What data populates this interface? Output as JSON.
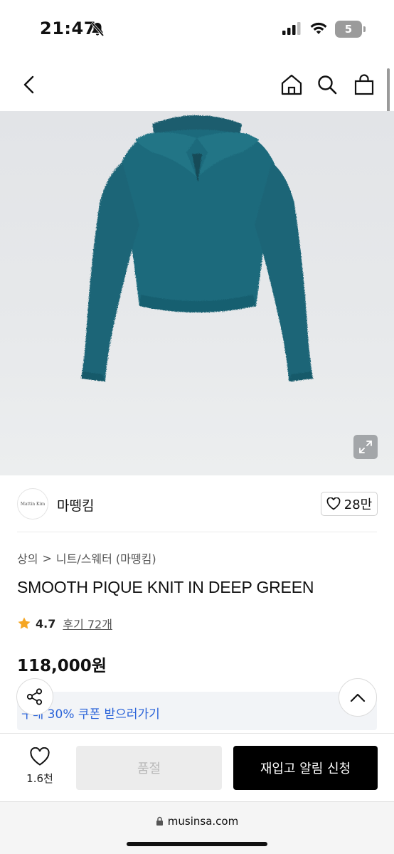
{
  "status": {
    "time": "21:47",
    "battery": "5"
  },
  "nav": {
    "icons": [
      "back-icon",
      "home-icon",
      "search-icon",
      "cart-icon"
    ]
  },
  "brand": {
    "logo_text": "Mattin Kim",
    "name": "마뗑킴",
    "likes": "28만"
  },
  "breadcrumb": {
    "category": "상의",
    "separator": ">",
    "subcategory": "니트/스웨터 (마뗑킴)"
  },
  "product": {
    "title": "SMOOTH PIQUE KNIT IN DEEP GREEN",
    "rating": "4.7",
    "reviews": "후기 72개",
    "price": "118,000원",
    "color": "#1c6a7c"
  },
  "coupon": {
    "text": "구매 30% 쿠폰 받으러가기"
  },
  "bottom": {
    "wish_count": "1.6천",
    "soldout_label": "품절",
    "restock_label": "재입고 알림 신청"
  },
  "browser": {
    "url": "musinsa.com"
  },
  "colors": {
    "accent_blue": "#2a63d9",
    "star": "#f5a623"
  }
}
